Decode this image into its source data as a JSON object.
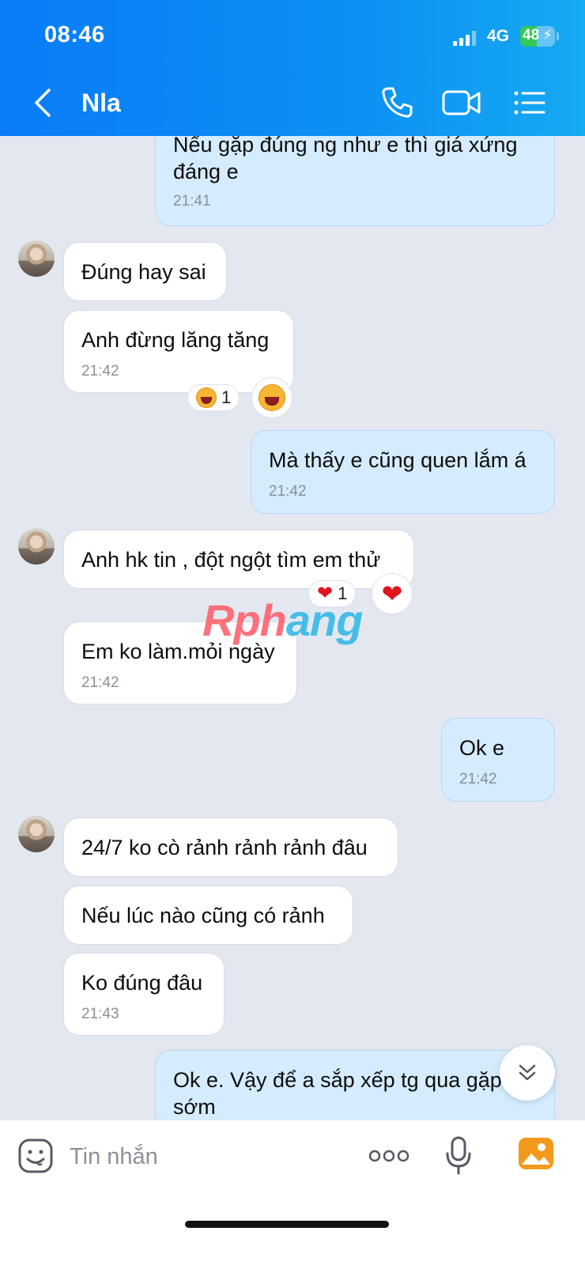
{
  "status": {
    "time": "08:46",
    "network": "4G",
    "battery": "48",
    "battery_level": 0.48
  },
  "header": {
    "contact_name": "Nla"
  },
  "messages": [
    {
      "id": 0,
      "side": "out",
      "text": "Nếu gặp đúng ng như e thì giá xứng đáng e",
      "time": "21:41"
    },
    {
      "id": 1,
      "side": "in",
      "text": "Đúng hay sai",
      "time": ""
    },
    {
      "id": 2,
      "side": "in",
      "text": "Anh đừng lăng tăng",
      "time": "21:42",
      "reaction": {
        "emoji": "laugh",
        "count": "1"
      }
    },
    {
      "id": 3,
      "side": "out",
      "text": "Mà thấy e cũng quen lắm á",
      "time": "21:42"
    },
    {
      "id": 4,
      "side": "in",
      "text": "Anh hk tin , đột ngột tìm em thử",
      "time": "",
      "reaction": {
        "emoji": "heart",
        "count": "1"
      }
    },
    {
      "id": 5,
      "side": "in",
      "text": "Em ko làm.mỏi ngày",
      "time": "21:42"
    },
    {
      "id": 6,
      "side": "out",
      "text": "Ok e",
      "time": "21:42"
    },
    {
      "id": 7,
      "side": "in",
      "text": "24/7 ko cò rảnh rảnh rảnh đâu",
      "time": ""
    },
    {
      "id": 8,
      "side": "in",
      "text": "Nếu lúc nào cũng có rảnh",
      "time": ""
    },
    {
      "id": 9,
      "side": "in",
      "text": "Ko đúng đâu",
      "time": "21:43"
    },
    {
      "id": 10,
      "side": "out",
      "text": "Ok e. Vậy để a sắp xếp tg qua gặp sớm",
      "time": ""
    }
  ],
  "watermark": {
    "part1": "Rph",
    "part2": "ang"
  },
  "input": {
    "placeholder": "Tin nhắn"
  },
  "colors": {
    "header": "#0a7cf6",
    "outgoing_bubble": "#d4ecfd",
    "incoming_bubble": "#ffffff",
    "chat_bg": "#e3e8f0"
  },
  "icons": [
    "back-icon",
    "phone-icon",
    "video-call-icon",
    "menu-list-icon",
    "sticker-icon",
    "more-icon",
    "microphone-icon",
    "image-icon",
    "chevron-double-down-icon"
  ]
}
